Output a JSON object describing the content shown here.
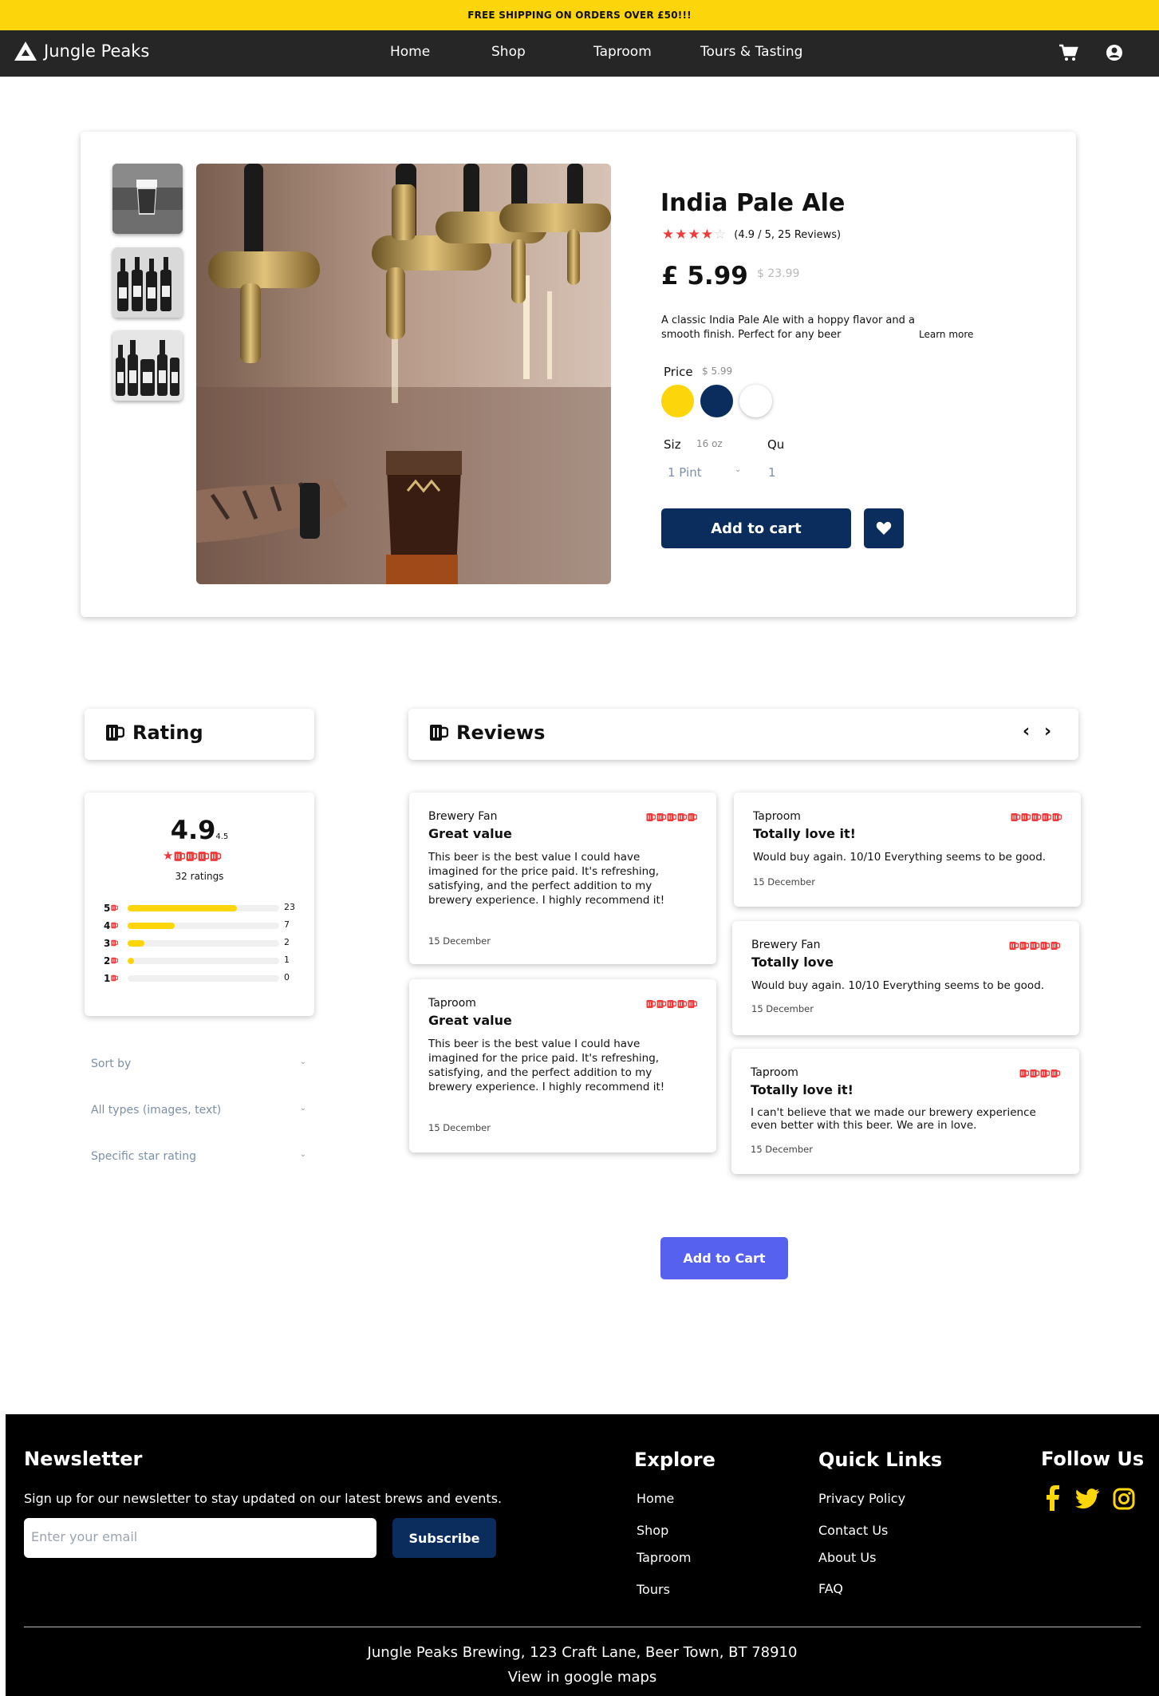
{
  "promo": {
    "text": "FREE SHIPPING ON ORDERS OVER £50!!!"
  },
  "nav": {
    "brand": "Jungle Peaks",
    "links": [
      "Home",
      "Shop",
      "Taproom",
      "Tours & Tasting"
    ],
    "icons": [
      "cart-icon",
      "user-icon"
    ]
  },
  "product": {
    "title": "India Pale Ale",
    "rating_text": "(4.9 / 5, 25 Reviews)",
    "stars": 4,
    "price": "£ 5.99",
    "old_price": "$ 23.99",
    "description": "A classic India Pale Ale with a hoppy flavor and a smooth finish. Perfect for any beer",
    "learn_more": "Learn more",
    "price_label": "Price",
    "price_sub": "$ 5.99",
    "colors": [
      "#fdd50b",
      "#0a2d5e",
      "#ffffff"
    ],
    "size_label": "Siz",
    "size_sub": "16 oz",
    "qty_label": "Qu",
    "size_value": "1 Pint",
    "qty_value": "1",
    "add_to_cart": "Add to cart"
  },
  "rating_panel": {
    "title": "Rating",
    "score": "4.9",
    "score_sub": "4.5",
    "ratings_count": "32 ratings",
    "bars": [
      {
        "label": "5",
        "count": "23",
        "fraction": 0.72
      },
      {
        "label": "4",
        "count": "7",
        "fraction": 0.31
      },
      {
        "label": "3",
        "count": "2",
        "fraction": 0.11
      },
      {
        "label": "2",
        "count": "1",
        "fraction": 0.03
      },
      {
        "label": "1",
        "count": "0",
        "fraction": 0.0
      }
    ],
    "filters": [
      "Sort by",
      "All types (images, text)",
      "Specific star rating"
    ]
  },
  "reviews_panel": {
    "title": "Reviews",
    "reviews": [
      {
        "author": "Brewery Fan",
        "title": "Great value",
        "text": "This beer is the best value I could have imagined for the price paid. It's refreshing, satisfying, and the perfect addition to my brewery experience. I highly recommend it!",
        "date": "15 December",
        "mugs": 5
      },
      {
        "author": "Taproom",
        "title": "Great value",
        "text": "This beer is the best value I could have imagined for the price paid. It's refreshing, satisfying, and the perfect addition to my brewery experience. I highly recommend it!",
        "date": "15 December",
        "mugs": 5
      },
      {
        "author": "Taproom",
        "title": "Totally love it!",
        "text": "Would buy again. 10/10 Everything seems to be good.",
        "date": "15 December",
        "mugs": 5
      },
      {
        "author": "Brewery Fan",
        "title": "Totally love",
        "text": "Would buy again. 10/10 Everything seems to be good.",
        "date": "15 December",
        "mugs": 5
      },
      {
        "author": "Taproom",
        "title": "Totally love it!",
        "text": "I can't believe that we made our brewery experience even better with this beer. We are in love.",
        "date": "15 December",
        "mugs": 4
      }
    ]
  },
  "cta": {
    "label": "Add to Cart"
  },
  "footer": {
    "newsletter_title": "Newsletter",
    "newsletter_text": "Sign up for our newsletter to stay updated on our latest brews and events.",
    "email_placeholder": "Enter your email",
    "subscribe": "Subscribe",
    "explore_title": "Explore",
    "explore_links": [
      "Home",
      "Shop",
      "Taproom",
      "Tours"
    ],
    "quick_title": "Quick Links",
    "quick_links": [
      "Privacy Policy",
      "Contact Us",
      "About Us",
      "FAQ"
    ],
    "follow_title": "Follow Us",
    "social": [
      "facebook-icon",
      "twitter-icon",
      "instagram-icon"
    ],
    "address": "Jungle Peaks Brewing, 123 Craft Lane, Beer Town, BT 78910",
    "maps_link": "View in google maps"
  }
}
